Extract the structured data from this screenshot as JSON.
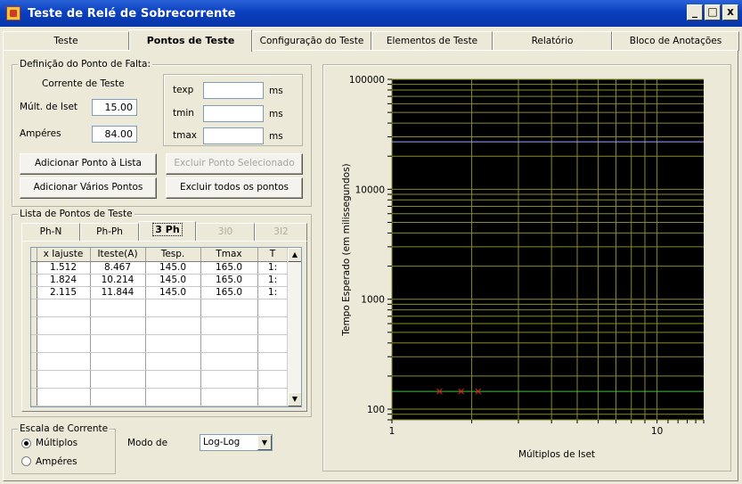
{
  "window": {
    "title": "Teste de Relé de Sobrecorrente",
    "min": "_",
    "max": "□",
    "close": "x"
  },
  "tabs": [
    {
      "label": "Teste"
    },
    {
      "label": "Pontos de Teste"
    },
    {
      "label": "Configuração do Teste"
    },
    {
      "label": "Elementos de Teste"
    },
    {
      "label": "Relatório"
    },
    {
      "label": "Bloco de Anotações"
    }
  ],
  "fault": {
    "group_title": "Definição do Ponto de Falta:",
    "current_title": "Corrente de Teste",
    "mult_label": "Múlt. de Iset",
    "mult_value": "15.00",
    "amps_label": "Ampéres",
    "amps_value": "84.00",
    "texp_label": "texp",
    "texp_value": "",
    "texp_unit": "ms",
    "tmin_label": "tmin",
    "tmin_value": "",
    "tmin_unit": "ms",
    "tmax_label": "tmax",
    "tmax_value": "",
    "tmax_unit": "ms"
  },
  "buttons": {
    "add_point": "Adicionar Ponto à Lista",
    "delete_selected": "Excluir Ponto Selecionado",
    "add_many": "Adicionar Vários Pontos",
    "delete_all": "Excluir todos os pontos"
  },
  "list": {
    "group_title": "Lista de Pontos de Teste",
    "tabs": [
      "Ph-N",
      "Ph-Ph",
      "3 Ph",
      "3I0",
      "3I2"
    ],
    "columns": [
      "x Iajuste",
      "Iteste(A)",
      "Tesp.",
      "Tmax",
      "T"
    ],
    "rows": [
      [
        "1.512",
        "8.467",
        "145.0",
        "165.0",
        "1:"
      ],
      [
        "1.824",
        "10.214",
        "145.0",
        "165.0",
        "1:"
      ],
      [
        "2.115",
        "11.844",
        "145.0",
        "165.0",
        "1:"
      ]
    ]
  },
  "scale": {
    "group_title": "Escala de Corrente",
    "opt_multiples": "Múltiplos",
    "opt_amperes": "Ampéres",
    "selected": "Múltiplos",
    "mode_label": "Modo de",
    "mode_value": "Log-Log"
  },
  "chart_data": {
    "type": "scatter",
    "xlabel": "Múltiplos de Iset",
    "ylabel": "Tempo Esperado (em milissegundos)",
    "xscale": "log",
    "yscale": "log",
    "xlim": [
      1,
      15
    ],
    "ylim": [
      80,
      100000
    ],
    "x_ticks": [
      "1",
      "10"
    ],
    "y_ticks": [
      "100000",
      "10000",
      "1000",
      "100"
    ],
    "grid": true,
    "background": "#000000",
    "grid_color": "#8a8a2a",
    "points": [
      {
        "x": 1.512,
        "y": 145.0
      },
      {
        "x": 1.824,
        "y": 145.0
      },
      {
        "x": 2.115,
        "y": 145.0
      }
    ],
    "point_color": "#e02020",
    "hlines": [
      {
        "y": 27000,
        "color": "#a0a0ff"
      },
      {
        "y": 145,
        "color": "#40c040"
      }
    ]
  }
}
